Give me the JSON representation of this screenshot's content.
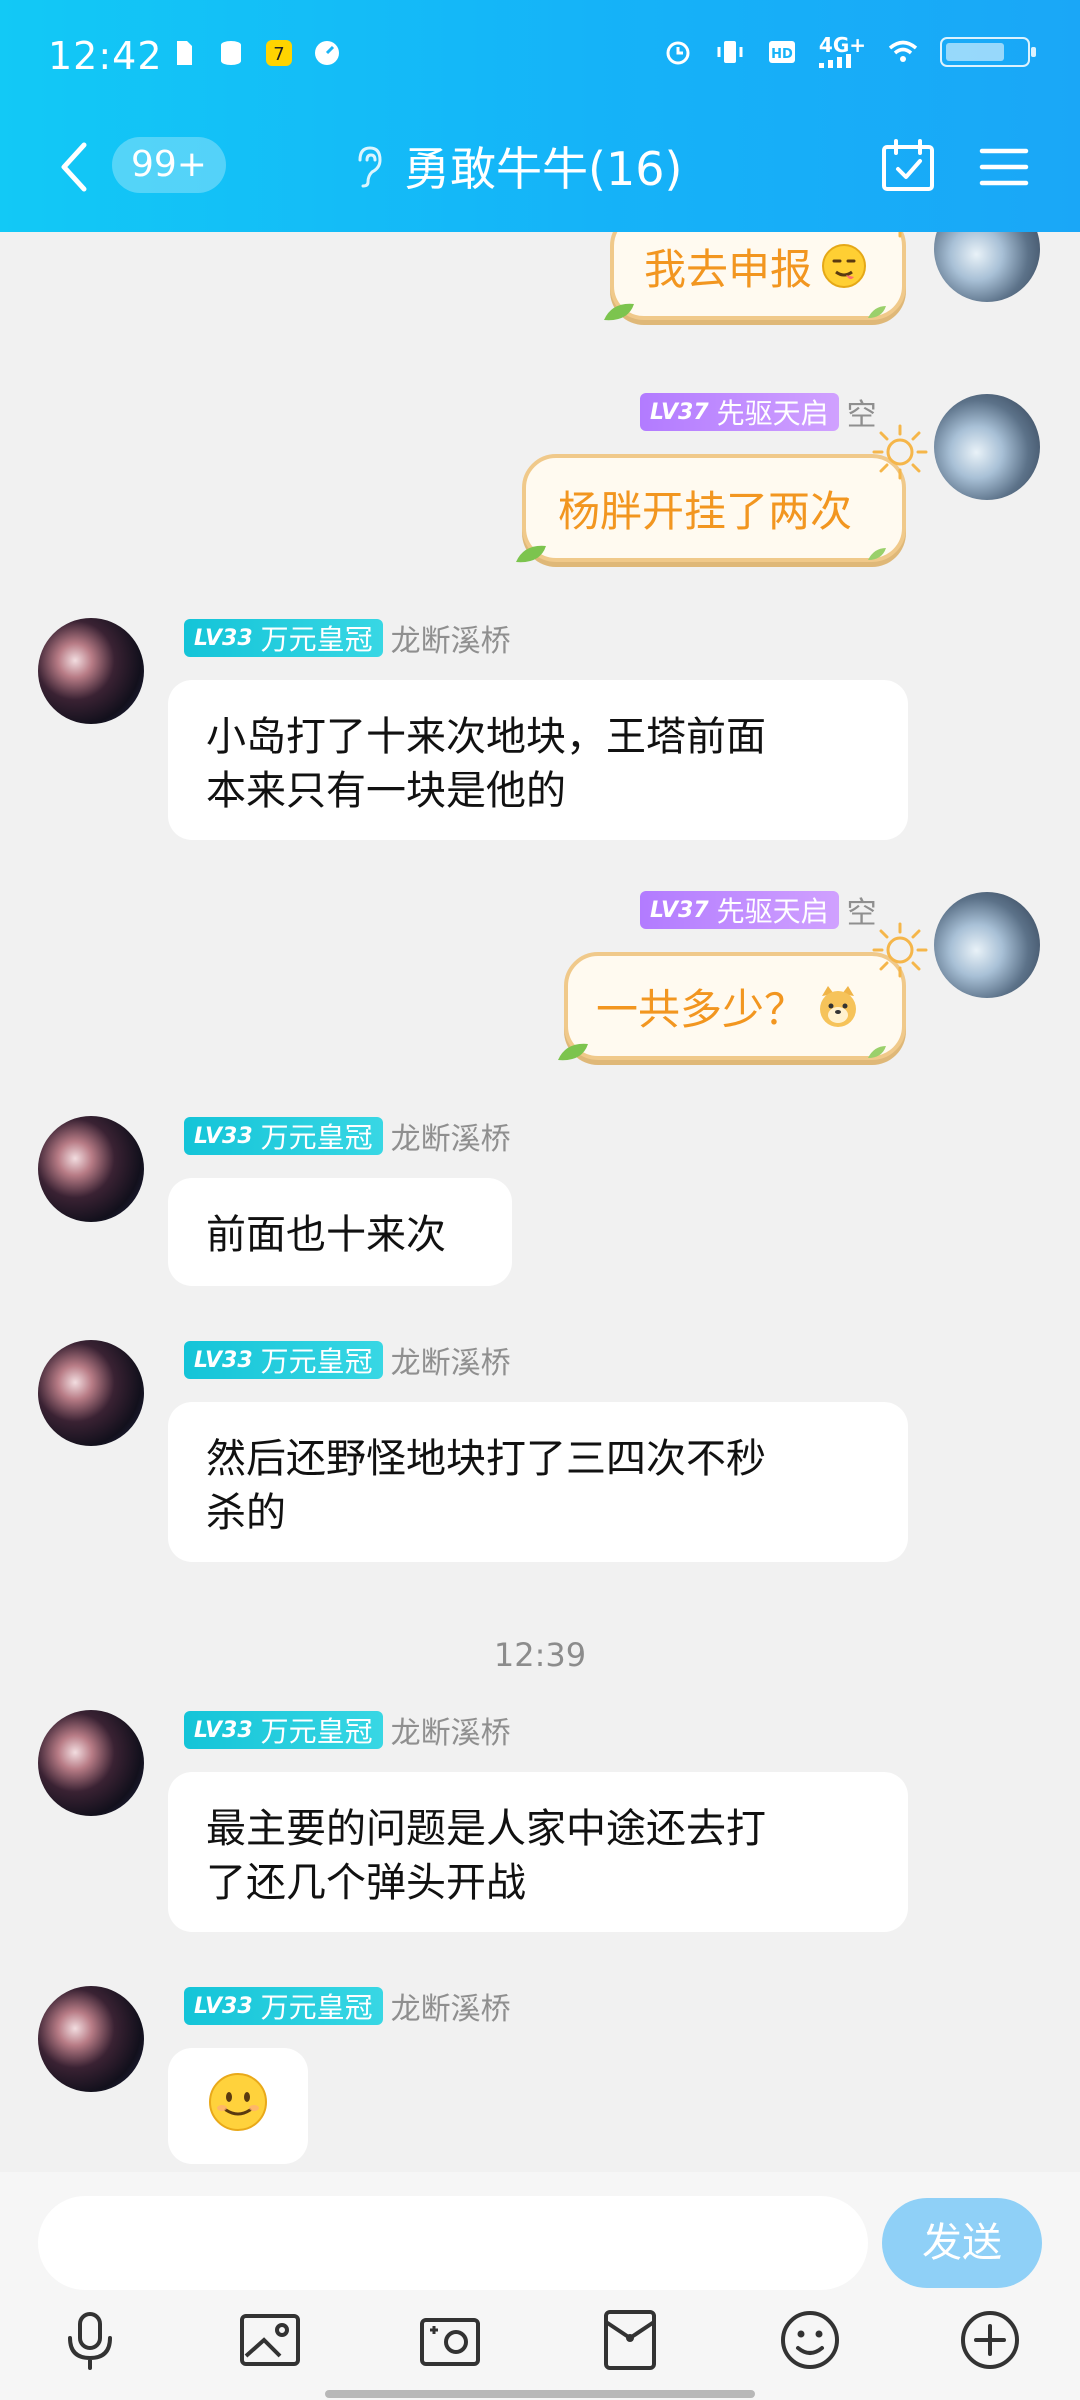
{
  "status_bar": {
    "time": "12:42",
    "network_label": "4G+"
  },
  "nav": {
    "unread_badge": "99+",
    "title": "勇敢牛牛(16)"
  },
  "messages": [
    {
      "direction": "out",
      "text": "我去申报",
      "emoji": "yum-face"
    },
    {
      "direction": "out",
      "level": "LV37",
      "badge": "先驱天启",
      "sender": "空",
      "text": "杨胖开挂了两次"
    },
    {
      "direction": "in",
      "level": "LV33",
      "badge": "万元皇冠",
      "sender": "龙断溪桥",
      "text_lines": [
        "小岛打了十来次地块，王塔前面",
        "本来只有一块是他的"
      ]
    },
    {
      "direction": "out",
      "level": "LV37",
      "badge": "先驱天启",
      "sender": "空",
      "text": "一共多少？",
      "emoji": "doge-face"
    },
    {
      "direction": "in",
      "level": "LV33",
      "badge": "万元皇冠",
      "sender": "龙断溪桥",
      "text_lines": [
        "前面也十来次"
      ]
    },
    {
      "direction": "in",
      "level": "LV33",
      "badge": "万元皇冠",
      "sender": "龙断溪桥",
      "text_lines": [
        "然后还野怪地块打了三四次不秒",
        "杀的"
      ]
    },
    {
      "direction": "in",
      "level": "LV33",
      "badge": "万元皇冠",
      "sender": "龙断溪桥",
      "text_lines": [
        "最主要的问题是人家中途还去打",
        "了还几个弹头开战"
      ]
    },
    {
      "direction": "in",
      "level": "LV33",
      "badge": "万元皇冠",
      "sender": "龙断溪桥",
      "emoji": "smile-face"
    }
  ],
  "timestamp": "12:39",
  "composer": {
    "send_label": "发送",
    "input_value": ""
  },
  "colors": {
    "header_start": "#12c9f6",
    "header_end": "#1aa7f7",
    "outgoing_text": "#f29620",
    "send_button": "#8fd0f7"
  }
}
